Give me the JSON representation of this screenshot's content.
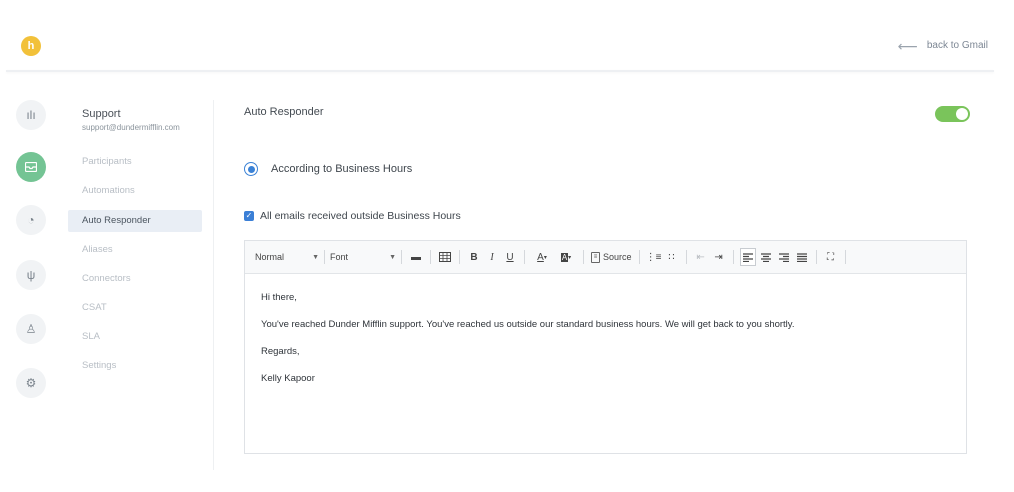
{
  "header": {
    "logo_letter": "h",
    "back_label": "back to Gmail",
    "back_icon": "arrow-left-icon"
  },
  "rail": {
    "icons": [
      {
        "name": "bar-chart-icon",
        "glyph": "ılı"
      },
      {
        "name": "inbox-icon",
        "glyph": "▭",
        "active": true
      },
      {
        "name": "pie-chart-icon",
        "glyph": "◔"
      },
      {
        "name": "plug-icon",
        "glyph": "ψ"
      },
      {
        "name": "user-icon",
        "glyph": "♙"
      },
      {
        "name": "settings-icon",
        "glyph": "⚙"
      }
    ]
  },
  "account": {
    "name": "Support",
    "email": "support@dundermifflin.com"
  },
  "subnav": {
    "items": [
      {
        "label": "Participants"
      },
      {
        "label": "Automations"
      },
      {
        "label": "Auto Responder",
        "active": true
      },
      {
        "label": "Aliases"
      },
      {
        "label": "Connectors"
      },
      {
        "label": "CSAT"
      },
      {
        "label": "SLA"
      },
      {
        "label": "Settings"
      }
    ]
  },
  "main": {
    "title": "Auto Responder",
    "toggle_on": true,
    "toggle_color": "#7ac45b",
    "radio_label": "According to Business Hours",
    "checkbox_label": "All emails received outside Business Hours"
  },
  "editor": {
    "format_select": "Normal",
    "font_select": "Font",
    "source_label": "Source",
    "lines": [
      "Hi there,",
      "You've reached Dunder Mifflin support. You've reached us outside our standard business hours. We will get back to you shortly.",
      "Regards,",
      "Kelly Kapoor"
    ]
  }
}
